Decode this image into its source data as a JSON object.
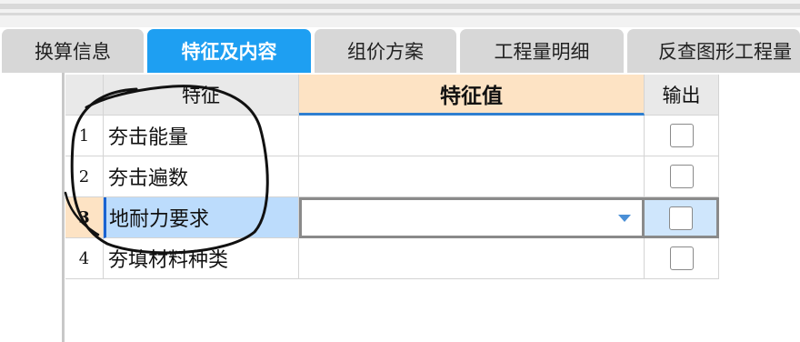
{
  "tabs": [
    {
      "label": "换算信息",
      "active": false
    },
    {
      "label": "特征及内容",
      "active": true
    },
    {
      "label": "组价方案",
      "active": false
    },
    {
      "label": "工程量明细",
      "active": false
    },
    {
      "label": "反查图形工程量",
      "active": false
    }
  ],
  "table": {
    "headers": {
      "feature": "特征",
      "value": "特征值",
      "output": "输出"
    },
    "rows": [
      {
        "num": "1",
        "feature": "夯击能量",
        "value": "",
        "output_checked": false
      },
      {
        "num": "2",
        "feature": "夯击遍数",
        "value": "",
        "output_checked": false
      },
      {
        "num": "3",
        "feature": "地耐力要求",
        "value": "",
        "output_checked": false,
        "selected": true
      },
      {
        "num": "4",
        "feature": "夯填材料种类",
        "value": "",
        "output_checked": false
      }
    ]
  },
  "colors": {
    "active_tab": "#1e9ff2",
    "value_header": "#fde3c4",
    "selected_cell": "#bcdcfc"
  }
}
